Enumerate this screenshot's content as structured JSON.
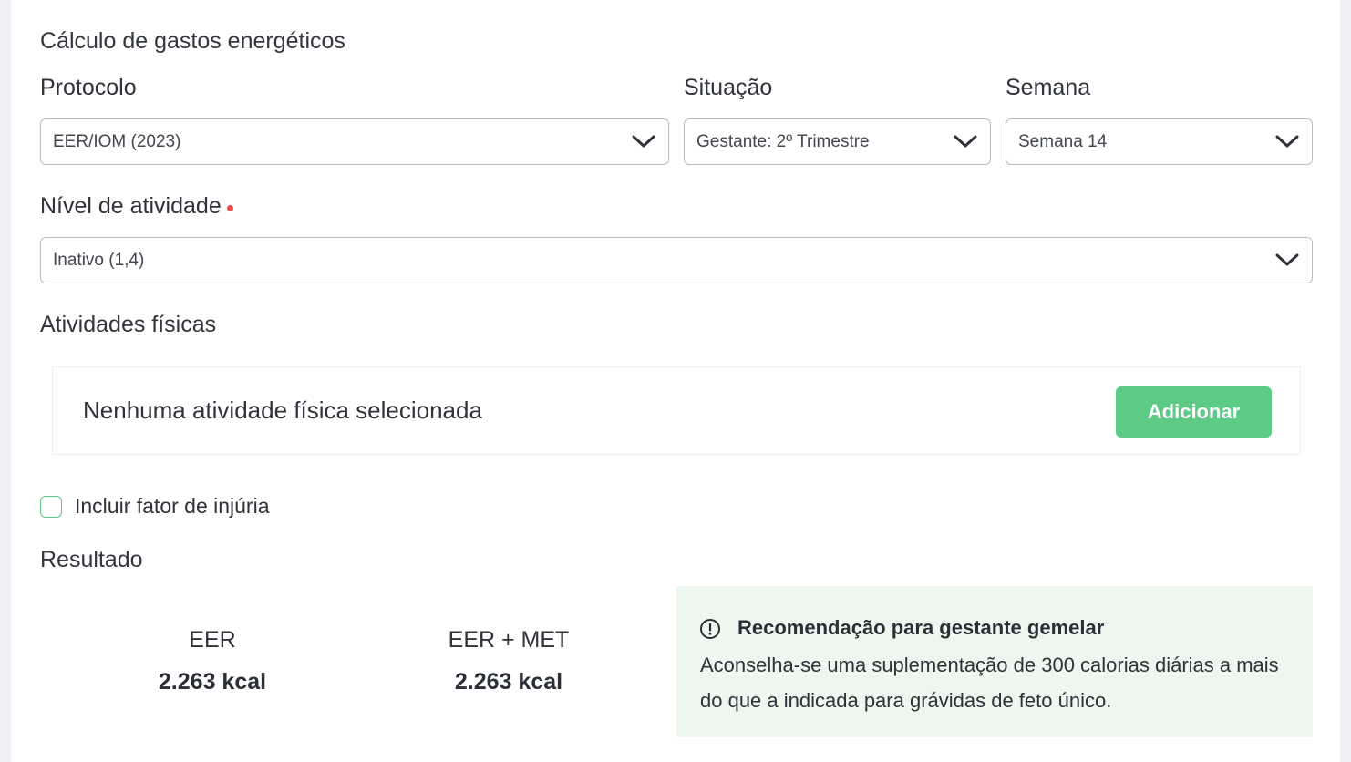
{
  "form": {
    "title": "Cálculo de gastos energéticos",
    "protocolo": {
      "label": "Protocolo",
      "value": "EER/IOM (2023)"
    },
    "situacao": {
      "label": "Situação",
      "value": "Gestante: 2º Trimestre"
    },
    "semana": {
      "label": "Semana",
      "value": "Semana 14"
    },
    "nivel_atividade": {
      "label": "Nível de atividade",
      "value": "Inativo (1,4)",
      "required": true
    }
  },
  "atividades": {
    "title": "Atividades físicas",
    "empty_text": "Nenhuma atividade física selecionada",
    "add_label": "Adicionar"
  },
  "injuria": {
    "label": "Incluir fator de injúria",
    "checked": false
  },
  "resultado": {
    "title": "Resultado",
    "eer": {
      "label": "EER",
      "value": "2.263 kcal"
    },
    "eer_met": {
      "label": "EER + MET",
      "value": "2.263 kcal"
    }
  },
  "notice": {
    "icon": "info-circle-icon",
    "title": "Recomendação para gestante gemelar",
    "body": "Aconselha-se uma suplementação de 300 calorias diárias a mais do que a indicada para grávidas de feto único."
  },
  "colors": {
    "accent_green": "#5dcb86",
    "notice_bg": "#ebf7ef",
    "required_dot": "#e5534b",
    "page_bg": "#eef0f3"
  }
}
